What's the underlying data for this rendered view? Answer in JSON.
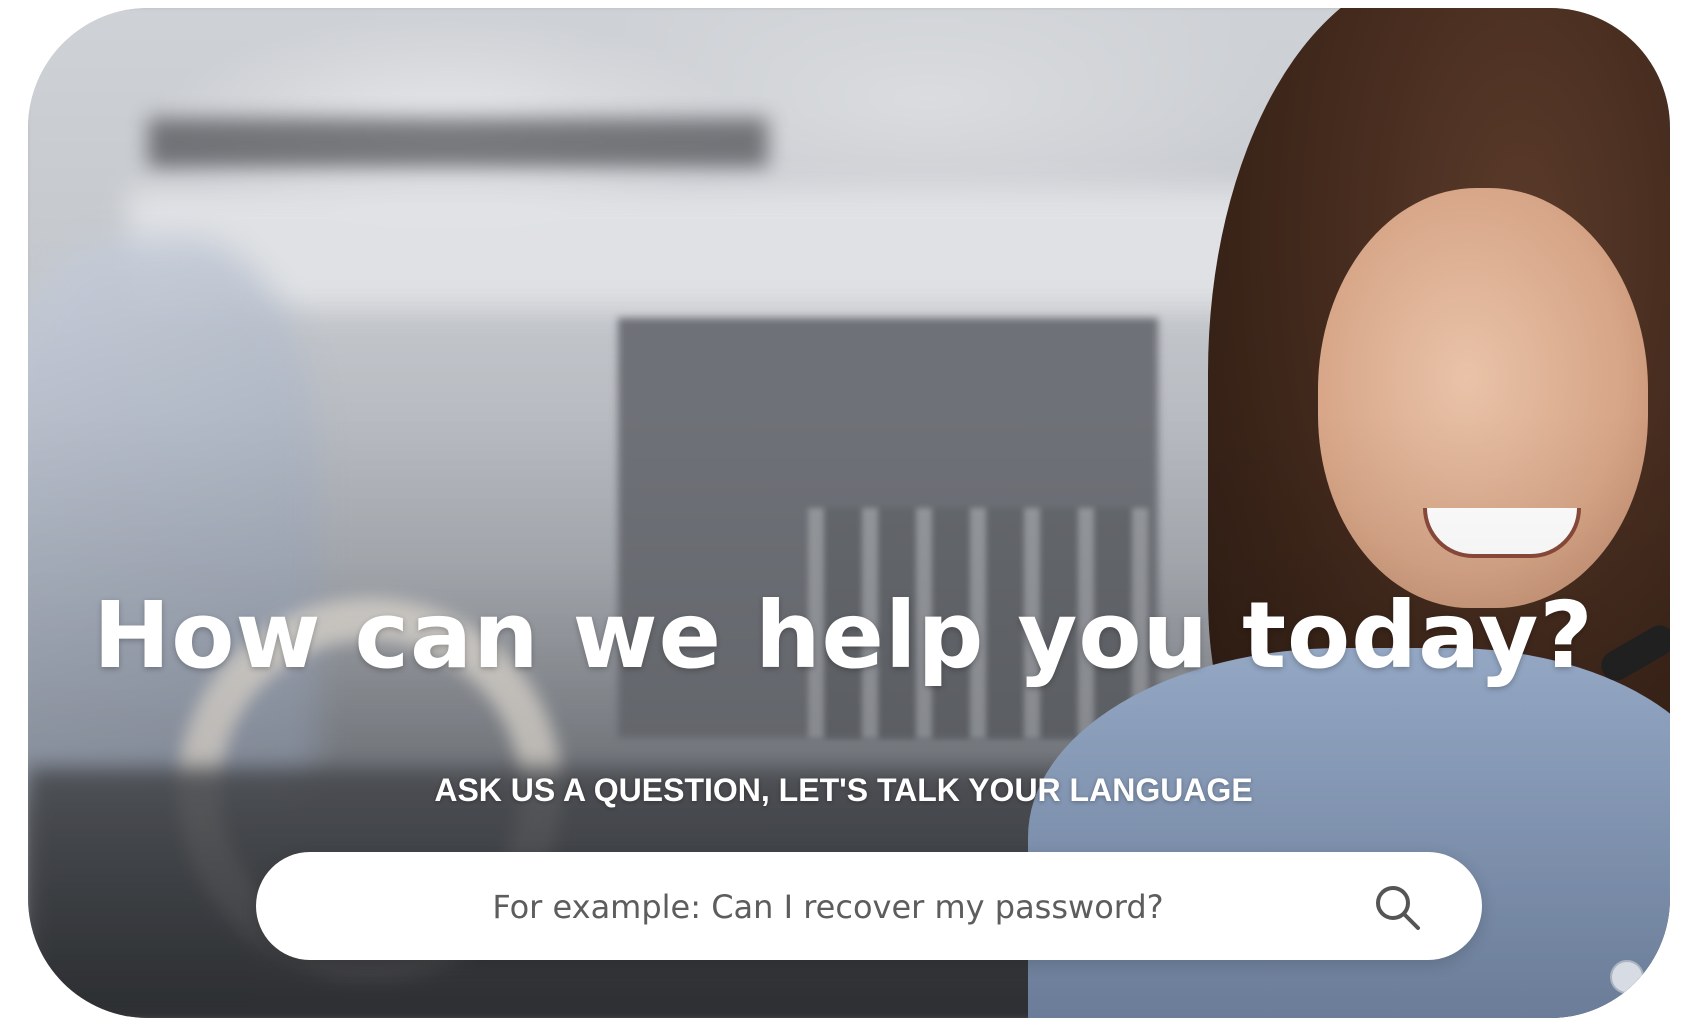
{
  "hero": {
    "headline": "How can we help you today?",
    "subheadline": "ASK US A QUESTION, LET'S TALK YOUR LANGUAGE"
  },
  "search": {
    "placeholder": "For example: Can I recover my password?",
    "value": "",
    "icon": "search-icon"
  },
  "colors": {
    "text": "#ffffff",
    "search_bg": "#ffffff",
    "placeholder": "#5d5d5d",
    "icon": "#555555"
  }
}
